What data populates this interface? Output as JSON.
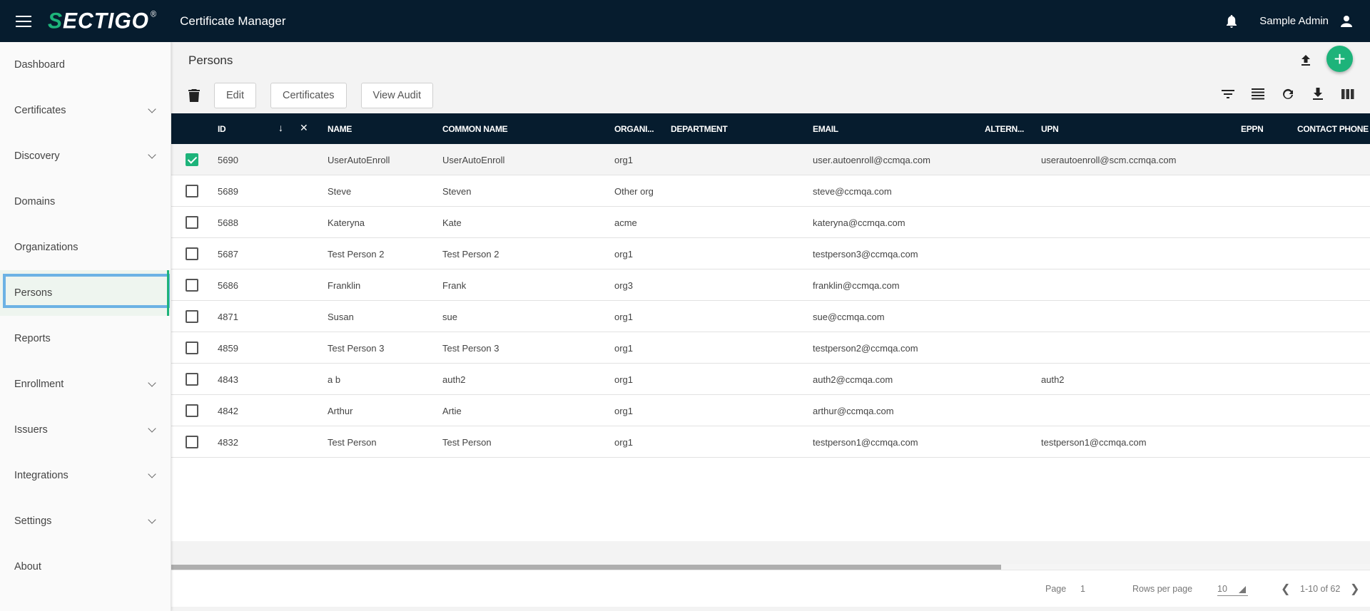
{
  "header": {
    "logo_s": "S",
    "logo_rest": "ECTIGO",
    "logo_reg": "®",
    "app_title": "Certificate Manager",
    "user_name": "Sample Admin"
  },
  "sidebar": {
    "items": [
      {
        "label": "Dashboard",
        "expandable": false
      },
      {
        "label": "Certificates",
        "expandable": true
      },
      {
        "label": "Discovery",
        "expandable": true
      },
      {
        "label": "Domains",
        "expandable": false
      },
      {
        "label": "Organizations",
        "expandable": false
      },
      {
        "label": "Persons",
        "expandable": false,
        "active": true
      },
      {
        "label": "Reports",
        "expandable": false
      },
      {
        "label": "Enrollment",
        "expandable": true
      },
      {
        "label": "Issuers",
        "expandable": true
      },
      {
        "label": "Integrations",
        "expandable": true
      },
      {
        "label": "Settings",
        "expandable": true
      },
      {
        "label": "About",
        "expandable": false
      }
    ]
  },
  "page": {
    "title": "Persons",
    "add_label": "+"
  },
  "toolbar": {
    "edit_label": "Edit",
    "certificates_label": "Certificates",
    "view_audit_label": "View Audit"
  },
  "table": {
    "columns": [
      {
        "key": "id",
        "label": "ID"
      },
      {
        "key": "name",
        "label": "NAME"
      },
      {
        "key": "common_name",
        "label": "COMMON NAME"
      },
      {
        "key": "organization",
        "label": "ORGANI..."
      },
      {
        "key": "department",
        "label": "DEPARTMENT"
      },
      {
        "key": "email",
        "label": "EMAIL"
      },
      {
        "key": "alternative",
        "label": "ALTERN..."
      },
      {
        "key": "upn",
        "label": "UPN"
      },
      {
        "key": "eppn",
        "label": "EPPN"
      },
      {
        "key": "contact_phone",
        "label": "CONTACT PHONE"
      }
    ],
    "sort_icon": "↓",
    "clear_icon": "✕",
    "rows": [
      {
        "selected": true,
        "id": "5690",
        "name": "UserAutoEnroll",
        "common_name": "UserAutoEnroll",
        "organization": "org1",
        "department": "",
        "email": "user.autoenroll@ccmqa.com",
        "alternative": "",
        "upn": "userautoenroll@scm.ccmqa.com",
        "eppn": "",
        "contact_phone": ""
      },
      {
        "selected": false,
        "id": "5689",
        "name": "Steve",
        "common_name": "Steven",
        "organization": "Other org",
        "department": "",
        "email": "steve@ccmqa.com",
        "alternative": "",
        "upn": "",
        "eppn": "",
        "contact_phone": ""
      },
      {
        "selected": false,
        "id": "5688",
        "name": "Kateryna",
        "common_name": "Kate",
        "organization": "acme",
        "department": "",
        "email": "kateryna@ccmqa.com",
        "alternative": "",
        "upn": "",
        "eppn": "",
        "contact_phone": ""
      },
      {
        "selected": false,
        "id": "5687",
        "name": "Test Person 2",
        "common_name": "Test Person 2",
        "organization": "org1",
        "department": "",
        "email": "testperson3@ccmqa.com",
        "alternative": "",
        "upn": "",
        "eppn": "",
        "contact_phone": ""
      },
      {
        "selected": false,
        "id": "5686",
        "name": "Franklin",
        "common_name": "Frank",
        "organization": "org3",
        "department": "",
        "email": "franklin@ccmqa.com",
        "alternative": "",
        "upn": "",
        "eppn": "",
        "contact_phone": ""
      },
      {
        "selected": false,
        "id": "4871",
        "name": "Susan",
        "common_name": "sue",
        "organization": "org1",
        "department": "",
        "email": "sue@ccmqa.com",
        "alternative": "",
        "upn": "",
        "eppn": "",
        "contact_phone": ""
      },
      {
        "selected": false,
        "id": "4859",
        "name": "Test Person 3",
        "common_name": "Test Person 3",
        "organization": "org1",
        "department": "",
        "email": "testperson2@ccmqa.com",
        "alternative": "",
        "upn": "",
        "eppn": "",
        "contact_phone": ""
      },
      {
        "selected": false,
        "id": "4843",
        "name": "a b",
        "common_name": "auth2",
        "organization": "org1",
        "department": "",
        "email": "auth2@ccmqa.com",
        "alternative": "",
        "upn": "auth2",
        "eppn": "",
        "contact_phone": ""
      },
      {
        "selected": false,
        "id": "4842",
        "name": "Arthur",
        "common_name": "Artie",
        "organization": "org1",
        "department": "",
        "email": "arthur@ccmqa.com",
        "alternative": "",
        "upn": "",
        "eppn": "",
        "contact_phone": ""
      },
      {
        "selected": false,
        "id": "4832",
        "name": "Test Person",
        "common_name": "Test Person",
        "organization": "org1",
        "department": "",
        "email": "testperson1@ccmqa.com",
        "alternative": "",
        "upn": "testperson1@ccmqa.com",
        "eppn": "",
        "contact_phone": ""
      }
    ]
  },
  "pagination": {
    "page_label": "Page",
    "page_value": "1",
    "rows_per_page_label": "Rows per page",
    "rows_per_page_value": "10",
    "range_label": "1-10 of 62"
  },
  "colors": {
    "header_bg": "#061c2e",
    "accent": "#1db37a",
    "focus_outline": "#6cb2e4"
  }
}
